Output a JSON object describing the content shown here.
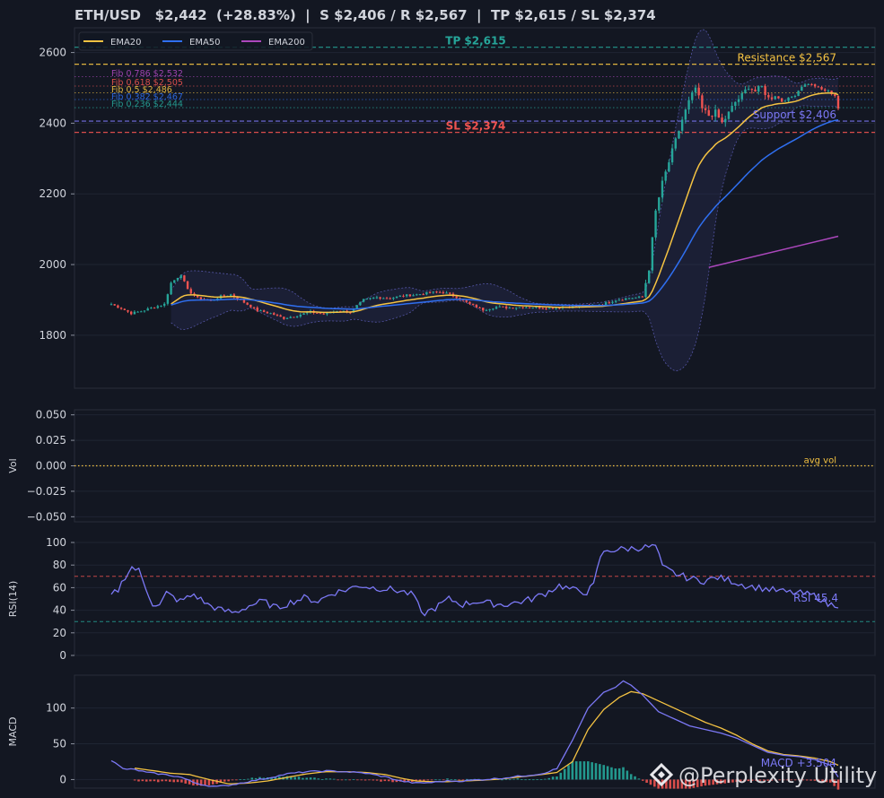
{
  "header": {
    "symbol": "ETH/USD",
    "price": "$2,442",
    "change": "(+28.83%)",
    "levels_sr": "S $2,406 / R $2,567",
    "levels_tp_sl": "TP $2,615 / SL $2,374"
  },
  "watermark": "@Perplexity Utility",
  "colors": {
    "bg": "#131722",
    "panel": "#131722",
    "grid": "#1f2533",
    "axis": "#2a2e39",
    "up": "#26a69a",
    "down": "#ef5350",
    "ema20": "#f5c342",
    "ema50": "#2f6ff0",
    "ema200": "#ab47bc",
    "tp": "#26a69a",
    "sl": "#ef5350",
    "resistance": "#f5c342",
    "support": "#7b78f5",
    "rsi": "#7b78f5",
    "macd": "#7b78f5",
    "signal": "#f5c342",
    "band": "#6e6ed8"
  },
  "chart_data": [
    {
      "type": "candlestick",
      "panel": "price",
      "ylim": [
        1650,
        2670
      ],
      "yticks": [
        1800,
        2000,
        2200,
        2400,
        2600
      ],
      "grid": true,
      "legend": {
        "placement": "top-left",
        "entries": [
          "EMA20",
          "EMA50",
          "EMA200"
        ]
      },
      "price_anchors": [
        [
          0,
          1888
        ],
        [
          3,
          1876
        ],
        [
          6,
          1862
        ],
        [
          9,
          1868
        ],
        [
          12,
          1877
        ],
        [
          16,
          1888
        ],
        [
          18,
          1948
        ],
        [
          21,
          1972
        ],
        [
          23,
          1928
        ],
        [
          26,
          1905
        ],
        [
          30,
          1898
        ],
        [
          33,
          1910
        ],
        [
          36,
          1915
        ],
        [
          40,
          1893
        ],
        [
          44,
          1870
        ],
        [
          48,
          1862
        ],
        [
          52,
          1848
        ],
        [
          56,
          1856
        ],
        [
          60,
          1866
        ],
        [
          64,
          1860
        ],
        [
          68,
          1870
        ],
        [
          72,
          1866
        ],
        [
          76,
          1900
        ],
        [
          80,
          1907
        ],
        [
          84,
          1905
        ],
        [
          88,
          1912
        ],
        [
          92,
          1915
        ],
        [
          96,
          1921
        ],
        [
          100,
          1922
        ],
        [
          104,
          1908
        ],
        [
          108,
          1888
        ],
        [
          112,
          1872
        ],
        [
          116,
          1880
        ],
        [
          120,
          1878
        ],
        [
          124,
          1880
        ],
        [
          128,
          1879
        ],
        [
          132,
          1877
        ],
        [
          136,
          1880
        ],
        [
          140,
          1881
        ],
        [
          144,
          1882
        ],
        [
          148,
          1888
        ],
        [
          152,
          1900
        ],
        [
          156,
          1905
        ],
        [
          160,
          1908
        ],
        [
          162,
          1990
        ],
        [
          164,
          2150
        ],
        [
          166,
          2230
        ],
        [
          168,
          2290
        ],
        [
          170,
          2350
        ],
        [
          172,
          2410
        ],
        [
          174,
          2460
        ],
        [
          176,
          2500
        ],
        [
          178,
          2440
        ],
        [
          180,
          2422
        ],
        [
          182,
          2430
        ],
        [
          184,
          2400
        ],
        [
          186,
          2428
        ],
        [
          188,
          2460
        ],
        [
          190,
          2478
        ],
        [
          192,
          2505
        ],
        [
          194,
          2490
        ],
        [
          196,
          2502
        ],
        [
          198,
          2470
        ],
        [
          200,
          2478
        ],
        [
          202,
          2462
        ],
        [
          204,
          2470
        ],
        [
          206,
          2480
        ],
        [
          208,
          2505
        ],
        [
          210,
          2512
        ],
        [
          212,
          2505
        ],
        [
          214,
          2495
        ],
        [
          216,
          2490
        ],
        [
          218,
          2478
        ],
        [
          219,
          2442
        ]
      ],
      "ema20_start": 18,
      "ema50_start": 18,
      "ema200": [
        [
          180,
          1992
        ],
        [
          219,
          2080
        ]
      ],
      "bollinger_start": 18,
      "levels": [
        {
          "name": "tp",
          "value": 2615,
          "label": "TP $2,615"
        },
        {
          "name": "resistance",
          "value": 2567,
          "label": "Resistance $2,567"
        },
        {
          "name": "fib-0786",
          "value": 2532,
          "label": "Fib 0.786 $2,532",
          "color": "#ab47bc"
        },
        {
          "name": "fib-0618",
          "value": 2505,
          "label": "Fib 0.618 $2,505",
          "color": "#ef5350"
        },
        {
          "name": "fib-05",
          "value": 2486,
          "label": "Fib 0.5 $2,486",
          "color": "#f5c342"
        },
        {
          "name": "fib-0382",
          "value": 2467,
          "label": "Fib 0.382 $2,467",
          "color": "#2f6ff0"
        },
        {
          "name": "fib-0236",
          "value": 2444,
          "label": "Fib 0.236 $2,444",
          "color": "#26a69a"
        },
        {
          "name": "support",
          "value": 2406,
          "label": "Support $2,406"
        },
        {
          "name": "sl",
          "value": 2374,
          "label": "SL $2,374"
        }
      ]
    },
    {
      "type": "bar",
      "panel": "volume",
      "ylabel": "Vol",
      "ylim": [
        -0.055,
        0.055
      ],
      "yticks": [
        -0.05,
        -0.025,
        0.0,
        0.025,
        0.05
      ],
      "ytick_labels": [
        "−0.050",
        "−0.025",
        "0.000",
        "0.025",
        "0.050"
      ],
      "values": [],
      "annotations": [
        {
          "name": "avg-vol",
          "value": 0.0,
          "label": "avg vol"
        }
      ]
    },
    {
      "type": "line",
      "panel": "rsi",
      "ylabel": "RSI(14)",
      "ylim": [
        0,
        100
      ],
      "yticks": [
        0,
        20,
        40,
        60,
        80,
        100
      ],
      "bands": [
        70,
        30
      ],
      "value_label": "RSI 45.4",
      "anchors": [
        [
          0,
          53
        ],
        [
          2,
          58
        ],
        [
          4,
          70
        ],
        [
          6,
          78
        ],
        [
          8,
          75
        ],
        [
          10,
          60
        ],
        [
          12,
          46
        ],
        [
          14,
          44
        ],
        [
          16,
          55
        ],
        [
          20,
          48
        ],
        [
          24,
          54
        ],
        [
          28,
          45
        ],
        [
          32,
          40
        ],
        [
          36,
          38
        ],
        [
          40,
          44
        ],
        [
          44,
          48
        ],
        [
          48,
          42
        ],
        [
          52,
          47
        ],
        [
          56,
          51
        ],
        [
          60,
          48
        ],
        [
          64,
          55
        ],
        [
          68,
          58
        ],
        [
          72,
          62
        ],
        [
          76,
          60
        ],
        [
          80,
          59
        ],
        [
          84,
          57
        ],
        [
          88,
          53
        ],
        [
          90,
          36
        ],
        [
          94,
          42
        ],
        [
          98,
          50
        ],
        [
          102,
          45
        ],
        [
          106,
          48
        ],
        [
          110,
          46
        ],
        [
          114,
          45
        ],
        [
          118,
          47
        ],
        [
          122,
          50
        ],
        [
          126,
          55
        ],
        [
          130,
          62
        ],
        [
          134,
          58
        ],
        [
          138,
          56
        ],
        [
          140,
          62
        ],
        [
          142,
          88
        ],
        [
          144,
          93
        ],
        [
          148,
          94
        ],
        [
          152,
          95
        ],
        [
          156,
          96
        ],
        [
          158,
          97
        ],
        [
          160,
          78
        ],
        [
          164,
          72
        ],
        [
          168,
          68
        ],
        [
          172,
          66
        ],
        [
          176,
          69
        ],
        [
          180,
          66
        ],
        [
          184,
          62
        ],
        [
          188,
          60
        ],
        [
          192,
          58
        ],
        [
          196,
          56
        ],
        [
          200,
          55
        ],
        [
          204,
          53
        ],
        [
          206,
          50
        ],
        [
          208,
          45
        ],
        [
          210,
          45
        ]
      ]
    },
    {
      "type": "bar",
      "panel": "macd",
      "ylabel": "MACD",
      "ylim": [
        -12,
        146
      ],
      "yticks": [
        0,
        50,
        100
      ],
      "value_label": "MACD +3.504",
      "macd_anchors": [
        [
          0,
          27
        ],
        [
          3,
          15
        ],
        [
          6,
          14
        ],
        [
          9,
          10
        ],
        [
          12,
          8
        ],
        [
          15,
          6
        ],
        [
          18,
          3
        ],
        [
          21,
          -4
        ],
        [
          24,
          -8
        ],
        [
          27,
          -10
        ],
        [
          30,
          -8
        ],
        [
          35,
          -3
        ],
        [
          40,
          2
        ],
        [
          45,
          8
        ],
        [
          50,
          11
        ],
        [
          55,
          12
        ],
        [
          60,
          11
        ],
        [
          65,
          9
        ],
        [
          70,
          4
        ],
        [
          74,
          -2
        ],
        [
          78,
          -5
        ],
        [
          82,
          -4
        ],
        [
          86,
          -2
        ],
        [
          90,
          -2
        ],
        [
          95,
          0
        ],
        [
          100,
          2
        ],
        [
          105,
          5
        ],
        [
          110,
          8
        ],
        [
          114,
          15
        ],
        [
          118,
          55
        ],
        [
          122,
          100
        ],
        [
          126,
          122
        ],
        [
          129,
          129
        ],
        [
          131,
          138
        ],
        [
          133,
          132
        ],
        [
          136,
          118
        ],
        [
          140,
          95
        ],
        [
          144,
          85
        ],
        [
          148,
          75
        ],
        [
          152,
          70
        ],
        [
          156,
          65
        ],
        [
          160,
          58
        ],
        [
          164,
          48
        ],
        [
          168,
          38
        ],
        [
          172,
          34
        ],
        [
          176,
          32
        ],
        [
          180,
          28
        ],
        [
          184,
          20
        ],
        [
          186,
          3.5
        ]
      ],
      "signal_anchors": [
        [
          6,
          16
        ],
        [
          10,
          13
        ],
        [
          15,
          9
        ],
        [
          20,
          7
        ],
        [
          25,
          0
        ],
        [
          30,
          -6
        ],
        [
          35,
          -5
        ],
        [
          40,
          -2
        ],
        [
          45,
          3
        ],
        [
          50,
          8
        ],
        [
          55,
          11
        ],
        [
          60,
          11
        ],
        [
          65,
          10
        ],
        [
          70,
          7
        ],
        [
          74,
          2
        ],
        [
          78,
          -2
        ],
        [
          82,
          -3
        ],
        [
          86,
          -3
        ],
        [
          90,
          -2
        ],
        [
          95,
          -1
        ],
        [
          100,
          1
        ],
        [
          105,
          4
        ],
        [
          110,
          7
        ],
        [
          114,
          10
        ],
        [
          118,
          25
        ],
        [
          122,
          70
        ],
        [
          126,
          98
        ],
        [
          130,
          115
        ],
        [
          133,
          123
        ],
        [
          136,
          120
        ],
        [
          140,
          110
        ],
        [
          144,
          100
        ],
        [
          148,
          90
        ],
        [
          152,
          80
        ],
        [
          156,
          72
        ],
        [
          160,
          62
        ],
        [
          164,
          50
        ],
        [
          168,
          40
        ],
        [
          172,
          35
        ],
        [
          176,
          33
        ],
        [
          180,
          30
        ],
        [
          184,
          25
        ],
        [
          186,
          20
        ]
      ]
    }
  ]
}
